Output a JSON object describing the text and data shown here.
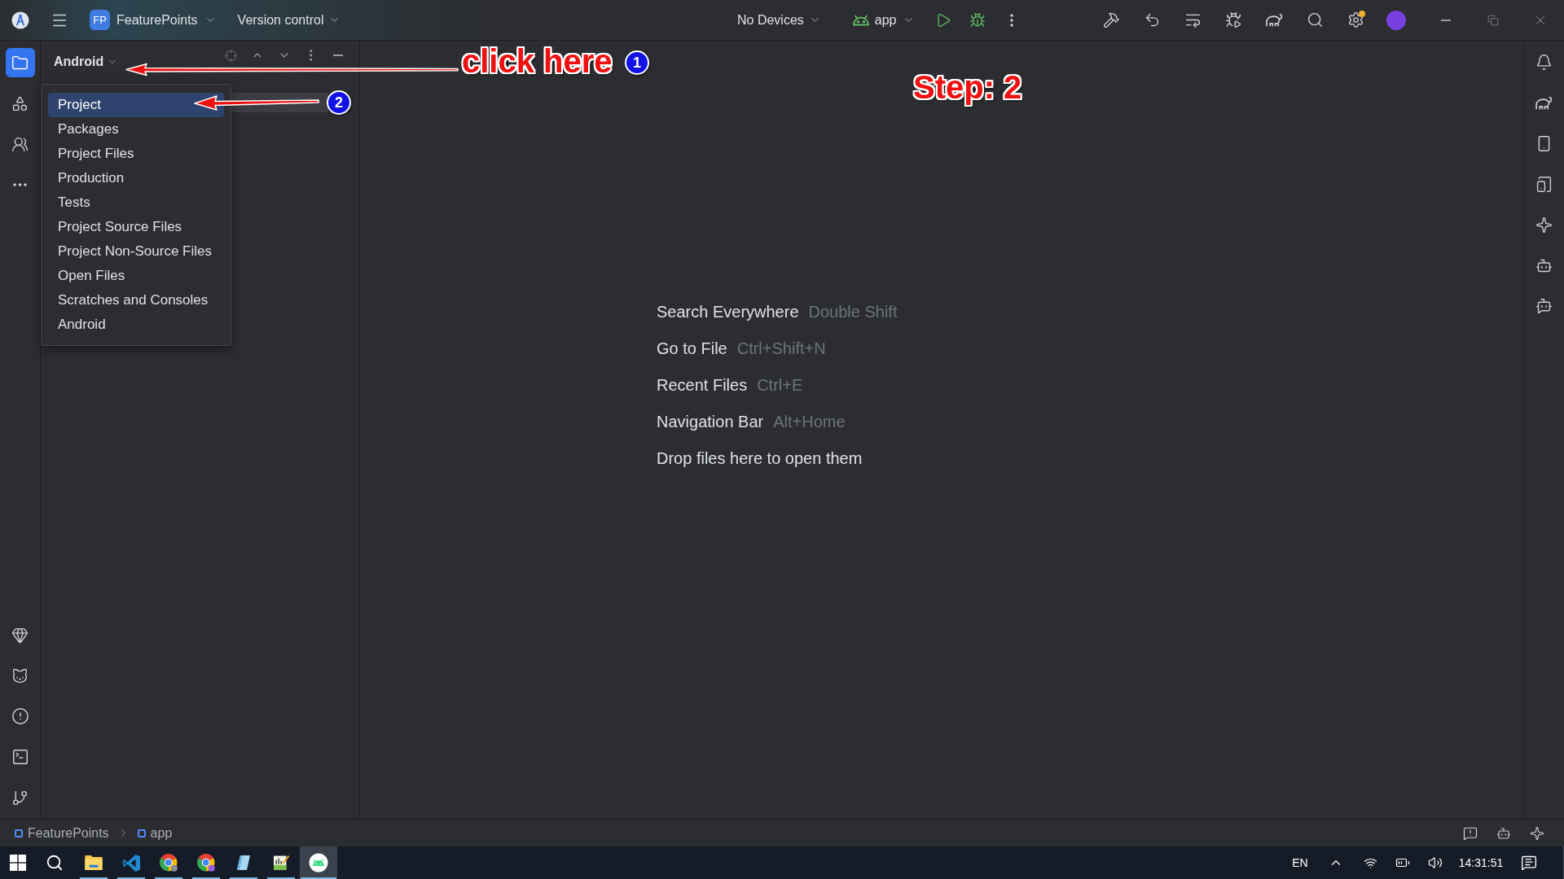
{
  "title_bar": {
    "project": {
      "initials": "FP",
      "name": "FeaturePoints"
    },
    "vcs_menu": "Version control",
    "device_selector": "No Devices",
    "run_configuration": "app"
  },
  "left_toolbar": {
    "tools": [
      {
        "selected": true
      },
      {
        "selected": false
      },
      {
        "selected": false
      }
    ]
  },
  "project_panel": {
    "view_selector": "Android",
    "view_menu": [
      {
        "label": "Project",
        "selected": true
      },
      {
        "label": "Packages",
        "selected": false
      },
      {
        "label": "Project Files",
        "selected": false
      },
      {
        "label": "Production",
        "selected": false
      },
      {
        "label": "Tests",
        "selected": false
      },
      {
        "label": "Project Source Files",
        "selected": false
      },
      {
        "label": "Project Non-Source Files",
        "selected": false
      },
      {
        "label": "Open Files",
        "selected": false
      },
      {
        "label": "Scratches and Consoles",
        "selected": false
      },
      {
        "label": "Android",
        "selected": false
      }
    ]
  },
  "editor_empty_state": {
    "hints": [
      {
        "action": "Search Everywhere",
        "shortcut": "Double Shift"
      },
      {
        "action": "Go to File",
        "shortcut": "Ctrl+Shift+N"
      },
      {
        "action": "Recent Files",
        "shortcut": "Ctrl+E"
      },
      {
        "action": "Navigation Bar",
        "shortcut": "Alt+Home"
      },
      {
        "action": "Drop files here to open them"
      }
    ]
  },
  "annotations": [
    {
      "kind": "label",
      "text": "click here"
    },
    {
      "kind": "badge",
      "text": "1"
    },
    {
      "kind": "badge",
      "text": "2"
    },
    {
      "kind": "label",
      "text": "Step: 2"
    }
  ],
  "breadcrumb": [
    "FeaturePoints",
    "app"
  ],
  "taskbar": {
    "apps": [
      {
        "running": true,
        "active": false
      },
      {
        "running": true,
        "active": false
      },
      {
        "running": true,
        "active": false
      },
      {
        "running": true,
        "active": false
      },
      {
        "running": true,
        "active": false
      },
      {
        "running": true,
        "active": false
      },
      {
        "running": true,
        "active": true
      }
    ],
    "language": "EN",
    "clock": "14:31:51"
  }
}
